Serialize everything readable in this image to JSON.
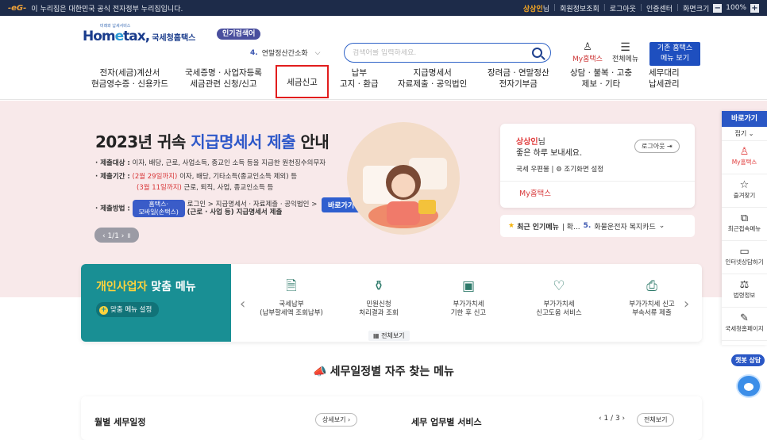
{
  "topbar": {
    "gov_logo": "-eG-",
    "gov_text": "이 누리집은 대한민국 공식 전자정부 누리집입니다.",
    "user": "상상인",
    "user_suffix": "님",
    "links": [
      "회원정보조회",
      "로그아웃",
      "인증센터",
      "화면크기"
    ],
    "zoom_minus": "−",
    "zoom": "100%",
    "zoom_plus": "+"
  },
  "header": {
    "logo_tiny": "미래와 납세서비스",
    "logo_main_a": "Hom",
    "logo_main_b": "e",
    "logo_main_c": "tax,",
    "logo_sub": "국세청홈택스",
    "popular_label": "인기검색어",
    "popular_rank": "4.",
    "popular_item": "연말정산간소화",
    "search_placeholder": "검색어를 입력하세요.",
    "my_hometax": "My홈택스",
    "all_menu": "전체메뉴",
    "prev_line1": "기존 홈택스",
    "prev_line2": "메뉴 보기"
  },
  "nav": [
    {
      "l1": "전자(세금)계산서",
      "l2": "현금영수증 · 신용카드"
    },
    {
      "l1": "국세증명 · 사업자등록",
      "l2": "세금관련 신청/신고"
    },
    {
      "l1": "세금신고",
      "l2": ""
    },
    {
      "l1": "납부",
      "l2": "고지 · 환급"
    },
    {
      "l1": "지급명세서",
      "l2": "자료제출 · 공익법인"
    },
    {
      "l1": "장려금 · 연말정산",
      "l2": "전자기부금"
    },
    {
      "l1": "상담 · 불복 · 고충",
      "l2": "제보 · 기타"
    },
    {
      "l1": "세무대리",
      "l2": "납세관리"
    }
  ],
  "banner": {
    "title_a": "2023년 귀속 ",
    "title_hi": "지급명세서 제출",
    "title_b": " 안내",
    "target_label": "· 제출대상 :",
    "target_text": " 이자, 배당, 근로, 사업소득, 종교인 소득 등을 지급한 원천징수의무자",
    "period_label": "· 제출기간 :",
    "period_1_red": " (2월 29일까지)",
    "period_1": " 이자, 배당, 기타소득(종교인소득 제외) 등",
    "period_2_red": "(3월 11일까지)",
    "period_2": " 근로, 퇴직, 사업, 종교인소득 등",
    "method_label": "· 제출방법 :",
    "method_pill_1": "홈택스·",
    "method_pill_2": "모바일(손택스)",
    "method_path_1": "로그인 > 지급명세서 · 자료제출 · 공익법인 >",
    "method_path_2": "(근로 · 사업 등) 지급명세서 제출",
    "go_button": "바로가기 ›",
    "pager": "‹  1/1  ›   ॥"
  },
  "login": {
    "user": "상상인",
    "user_suffix": "님",
    "greeting": "좋은 하루 보내세요.",
    "logout": "로그아웃 ⇥",
    "mailbox": "국세 우편물",
    "sep": "|",
    "home_setting": "⚙ 조기화면 설정",
    "my": "My홈택스"
  },
  "popular_bar": {
    "label": "최근 인기메뉴",
    "sep": "| 확...",
    "num": "5.",
    "item": "화물운전자 복지카드",
    "chev": "⌄"
  },
  "biz": {
    "title_y": "개인사업자",
    "title_w": " 맞춤 메뉴",
    "setting": "맞춤 메뉴 설정",
    "items": [
      {
        "l1": "국세납부",
        "l2": "(납부할세액 조회납부)"
      },
      {
        "l1": "민원신청",
        "l2": "처리결과 조회"
      },
      {
        "l1": "부가가치세",
        "l2": "기한 후 신고"
      },
      {
        "l1": "부가가치세",
        "l2": "신고도움 서비스"
      },
      {
        "l1": "부가가치세 신고",
        "l2": "부속서류 제출"
      }
    ],
    "all_view": "▦ 전체보기"
  },
  "schedule": {
    "title": "세무일정별 자주 찾는 메뉴",
    "monthly": "월별 세무일정",
    "more": "상세보기 ›",
    "service": "세무 업무별 서비스",
    "page": "‹  1 / 3  ›",
    "all": "전체보기"
  },
  "quick": {
    "header": "바로가기",
    "fold": "접기 ⌄",
    "items": [
      {
        "icon": "person-icon",
        "label": "My홈택스"
      },
      {
        "icon": "star-icon",
        "label": "즐겨찾기"
      },
      {
        "icon": "recent-icon",
        "label": "최근접속메뉴"
      },
      {
        "icon": "monitor-icon",
        "label": "인터넷상담하기"
      },
      {
        "icon": "law-icon",
        "label": "법령정보"
      },
      {
        "icon": "edit-icon",
        "label": "국세청홈페이지"
      }
    ],
    "chat": "챗봇 상담"
  },
  "colors": {
    "navy": "#1d2b49",
    "blue": "#2a57c5",
    "teal": "#198f94",
    "red": "#e21d1d",
    "banner": "#f8e9ea"
  }
}
